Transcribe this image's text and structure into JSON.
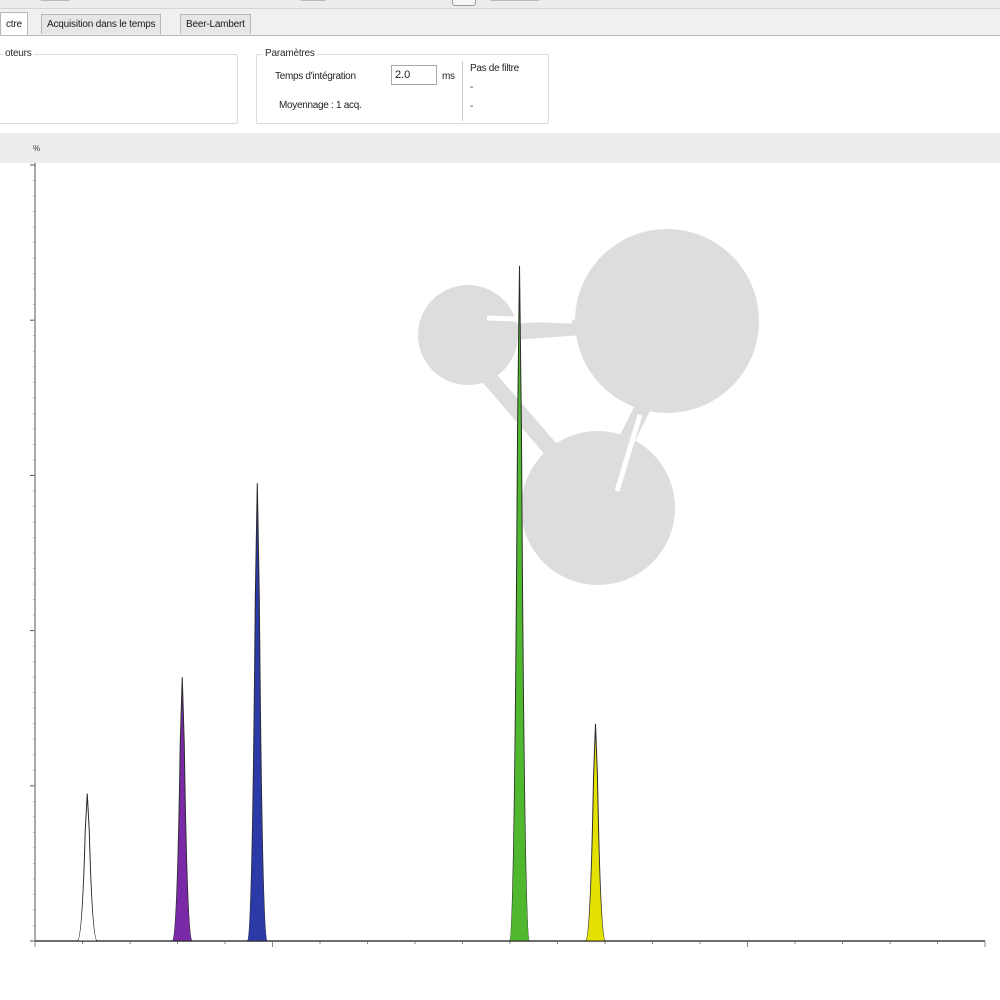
{
  "tabs": [
    {
      "label": "ctre",
      "active": true
    },
    {
      "label": "Acquisition dans le temps",
      "active": false
    },
    {
      "label": "Beer-Lambert",
      "active": false
    }
  ],
  "left_group": {
    "title": "oteurs"
  },
  "params": {
    "title": "Paramètres",
    "integration_label": "Temps d'intégration",
    "integration_value": "2.0",
    "integration_unit": "ms",
    "averaging_label": "Moyennage : 1 acq.",
    "filter_title": "Pas de filtre",
    "filter_line1": "-",
    "filter_line2": "-"
  },
  "chart_header": {
    "unit": "%"
  },
  "chart_data": {
    "type": "line",
    "title": "",
    "xlabel": "",
    "ylabel": "%",
    "ylim": [
      0,
      100
    ],
    "y_ticks": [
      0,
      20,
      40,
      60,
      80,
      100
    ],
    "grid": false,
    "legend": "none",
    "baseline_color": "#3d3d3d",
    "peaks": [
      {
        "position": 0.055,
        "height": 19,
        "color": "#ffffff"
      },
      {
        "position": 0.155,
        "height": 34,
        "color": "#7a2aa6"
      },
      {
        "position": 0.234,
        "height": 59,
        "color": "#2c3aa8"
      },
      {
        "position": 0.51,
        "height": 87,
        "color": "#4fb82e"
      },
      {
        "position": 0.59,
        "height": 28,
        "color": "#e4e000"
      }
    ]
  },
  "watermark": {
    "color": "#dddddd"
  }
}
